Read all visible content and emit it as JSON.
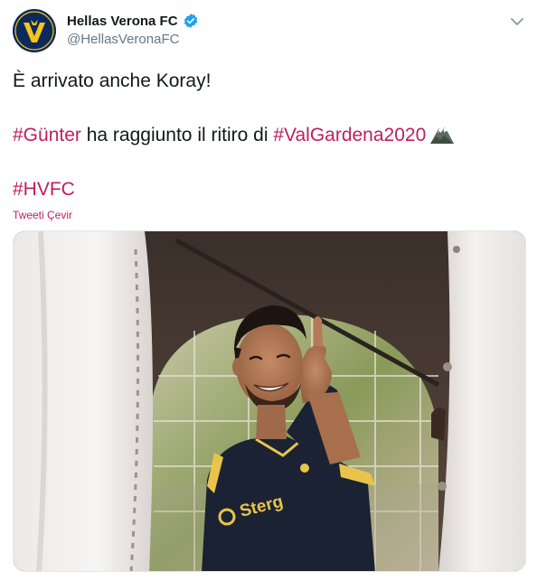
{
  "account": {
    "display_name": "Hellas Verona FC",
    "handle": "@HellasVeronaFC",
    "verified": true,
    "avatar_icon": "hellas-verona-crest-icon"
  },
  "tweet": {
    "line1": "È arrivato anche Koray!",
    "line2_hashtag1": "#Günter",
    "line2_text": " ha raggiunto il ritiro di ",
    "line2_hashtag2": "#ValGardena2020",
    "line2_emoji": "mountain-emoji",
    "line3_hashtag": "#HVFC",
    "translate_label": "Tweeti Çevir"
  },
  "media": {
    "jersey_sponsor": "Sterg"
  },
  "colors": {
    "hashtag": "#bf1e5d",
    "verified": "#1da1f2",
    "avatar_bg": "#0b2a5b",
    "crest": "#f5c518",
    "text": "#14171a",
    "muted": "#657786"
  }
}
